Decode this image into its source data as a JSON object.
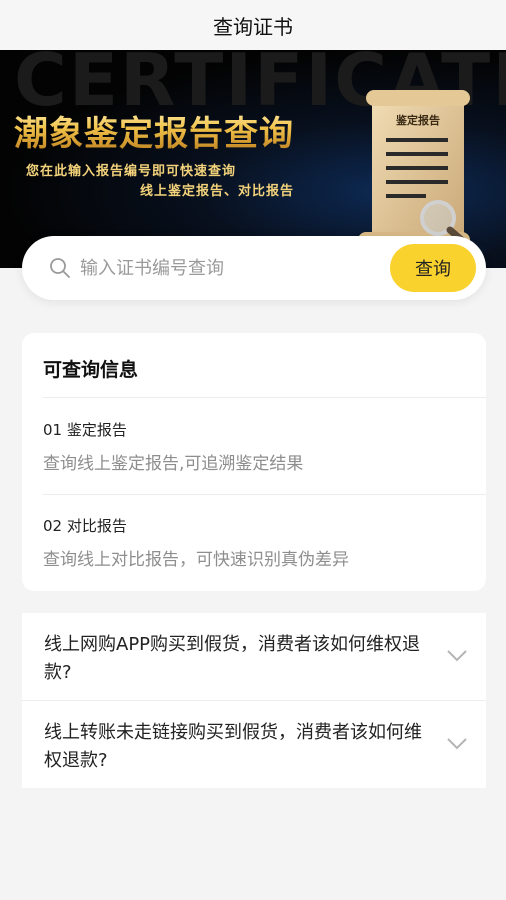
{
  "nav": {
    "title": "查询证书"
  },
  "banner": {
    "watermark": "CERTIFICATE",
    "title": "潮象鉴定报告查询",
    "subtitle_line1": "您在此输入报告编号即可快速查询",
    "subtitle_line2": "线上鉴定报告、对比报告",
    "scroll_label": "鉴定报告",
    "icons": [
      "scroll-document-icon",
      "magnifier-icon"
    ]
  },
  "search": {
    "placeholder": "输入证书编号查询",
    "value": "",
    "button_label": "查询",
    "icon": "search-icon",
    "button_color": "#fad22e"
  },
  "info": {
    "title": "可查询信息",
    "items": [
      {
        "title": "01 鉴定报告",
        "desc": "查询线上鉴定报告,可追溯鉴定结果"
      },
      {
        "title": "02 对比报告",
        "desc": "查询线上对比报告，可快速识别真伪差异"
      }
    ]
  },
  "faq": {
    "items": [
      {
        "text": "线上网购APP购买到假货，消费者该如何维权退款?",
        "icon": "chevron-down-icon"
      },
      {
        "text": "线上转账未走链接购买到假货，消费者该如何维权退款?",
        "icon": "chevron-down-icon"
      }
    ]
  },
  "colors": {
    "accent": "#fad22e",
    "banner_gold": "#f1c24a",
    "background": "#f4f4f4"
  }
}
